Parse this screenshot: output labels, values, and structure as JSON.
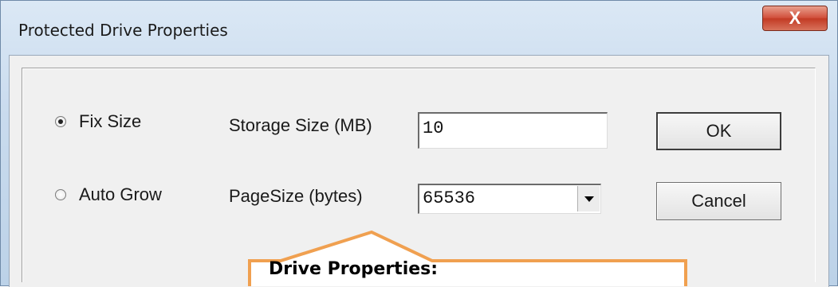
{
  "window": {
    "title": "Protected Drive Properties",
    "close_glyph": "X"
  },
  "options": {
    "fix_size_label": "Fix Size",
    "fix_size_checked": true,
    "auto_grow_label": "Auto Grow",
    "auto_grow_checked": false
  },
  "fields": {
    "storage_size_label": "Storage Size (MB)",
    "storage_size_value": "10",
    "page_size_label": "PageSize (bytes)",
    "page_size_value": "65536"
  },
  "buttons": {
    "ok_label": "OK",
    "cancel_label": "Cancel"
  },
  "callout": {
    "title": "Drive Properties:",
    "border_color": "#f0a050"
  }
}
